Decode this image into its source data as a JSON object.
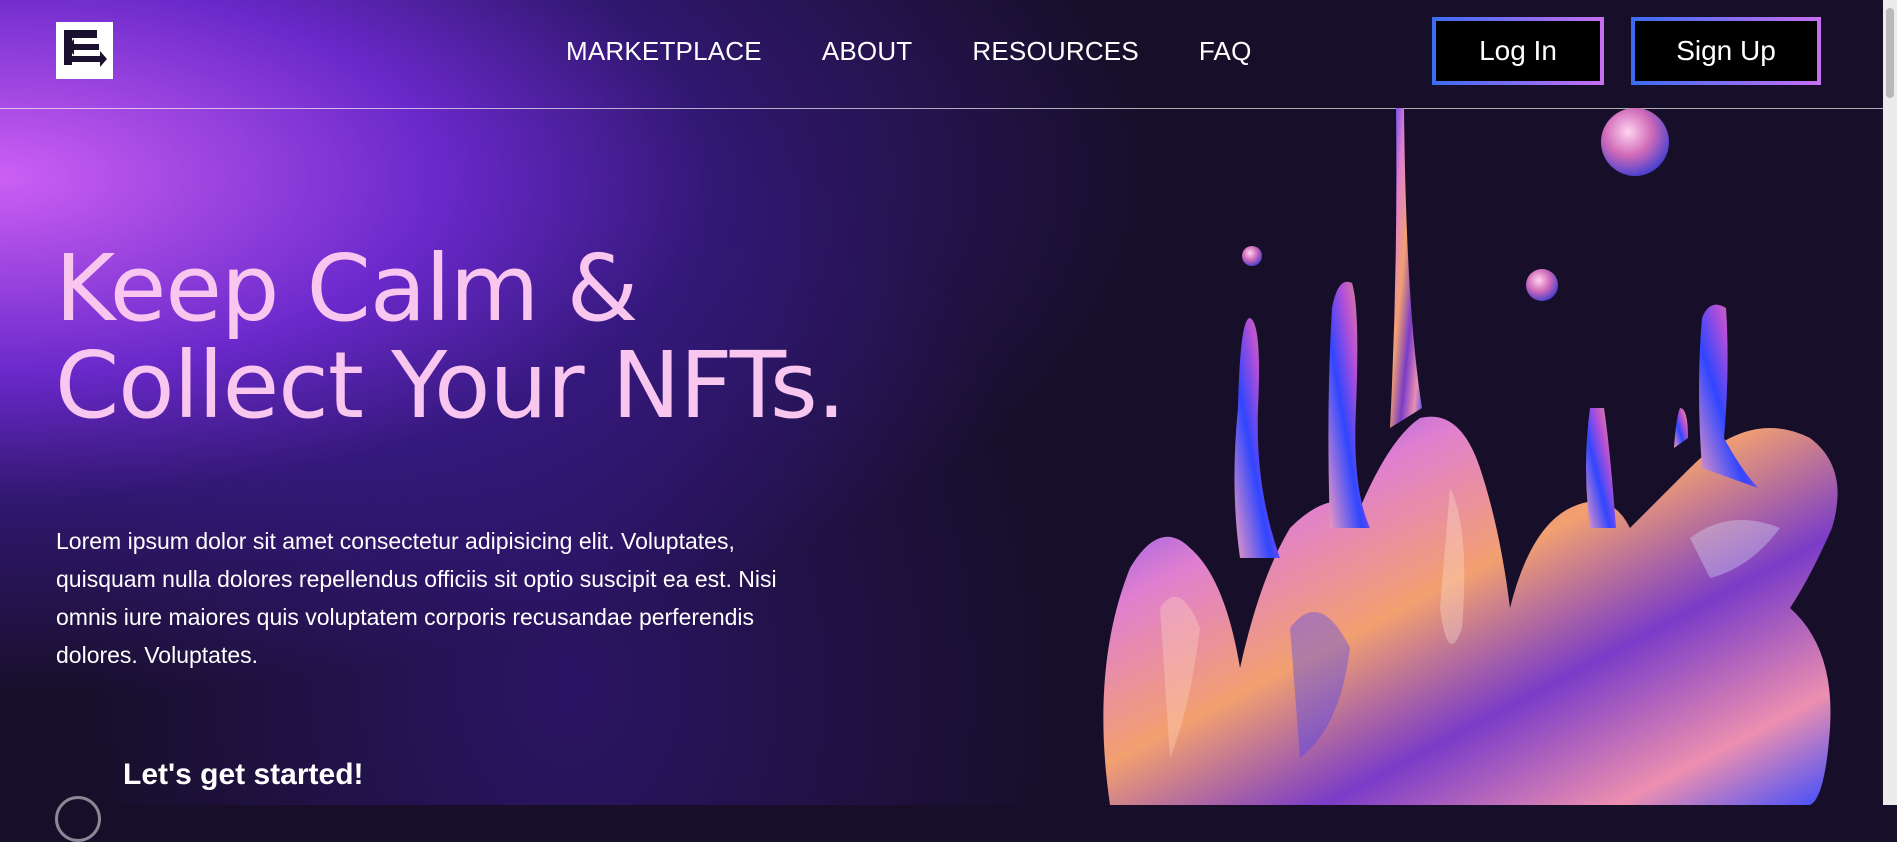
{
  "header": {
    "logo_icon": "box-arrows-logo-icon",
    "nav": [
      "MARKETPLACE",
      "ABOUT",
      "RESOURCES",
      "FAQ"
    ],
    "login_label": "Log In",
    "signup_label": "Sign Up"
  },
  "hero": {
    "title_line1": "Keep Calm &",
    "title_line2": "Collect Your NFTs.",
    "description": "Lorem ipsum dolor sit amet consectetur adipisicing elit. Voluptates, quisquam nulla dolores repellendus officiis sit optio suscipit ea est. Nisi omnis iure maiores quis voluptatem corporis recusandae perferendis dolores. Voluptates.",
    "cta": "Let's get started!"
  },
  "art": {
    "name": "iridescent-liquid-splash-image"
  },
  "colors": {
    "background": "#170f2a",
    "title_pink": "#f8c6ef",
    "accent_blue": "#3a6cf0",
    "accent_violet": "#c76ef2"
  }
}
